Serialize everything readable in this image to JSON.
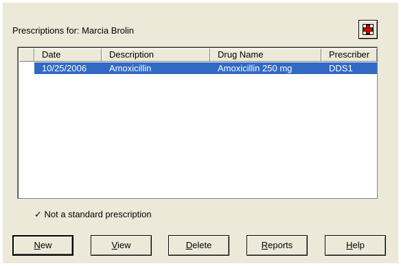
{
  "dialog": {
    "title_prefix": "Prescriptions for:",
    "patient_name": "Marcia Brolin",
    "rx_icon": "red-cross-icon",
    "colors": {
      "background": "#ece9d8",
      "selection": "#316ac5",
      "cross": "#e00000"
    }
  },
  "table": {
    "columns": [
      "Date",
      "Description",
      "Drug Name",
      "Prescriber"
    ],
    "rows": [
      {
        "date": "10/25/2006",
        "description": "Amoxicillin",
        "drug_name": "Amoxicillin 250 mg",
        "prescriber": "DDS1",
        "selected": true
      }
    ]
  },
  "legend": {
    "check": "✓",
    "text": "Not a standard prescription"
  },
  "buttons": [
    {
      "label": "New",
      "mnemonic": "N",
      "rest": "ew"
    },
    {
      "label": "View",
      "mnemonic": "V",
      "rest": "iew"
    },
    {
      "label": "Delete",
      "mnemonic": "D",
      "rest": "elete"
    },
    {
      "label": "Reports",
      "mnemonic": "R",
      "rest": "eports"
    },
    {
      "label": "Help",
      "mnemonic": "H",
      "rest": "elp"
    }
  ]
}
